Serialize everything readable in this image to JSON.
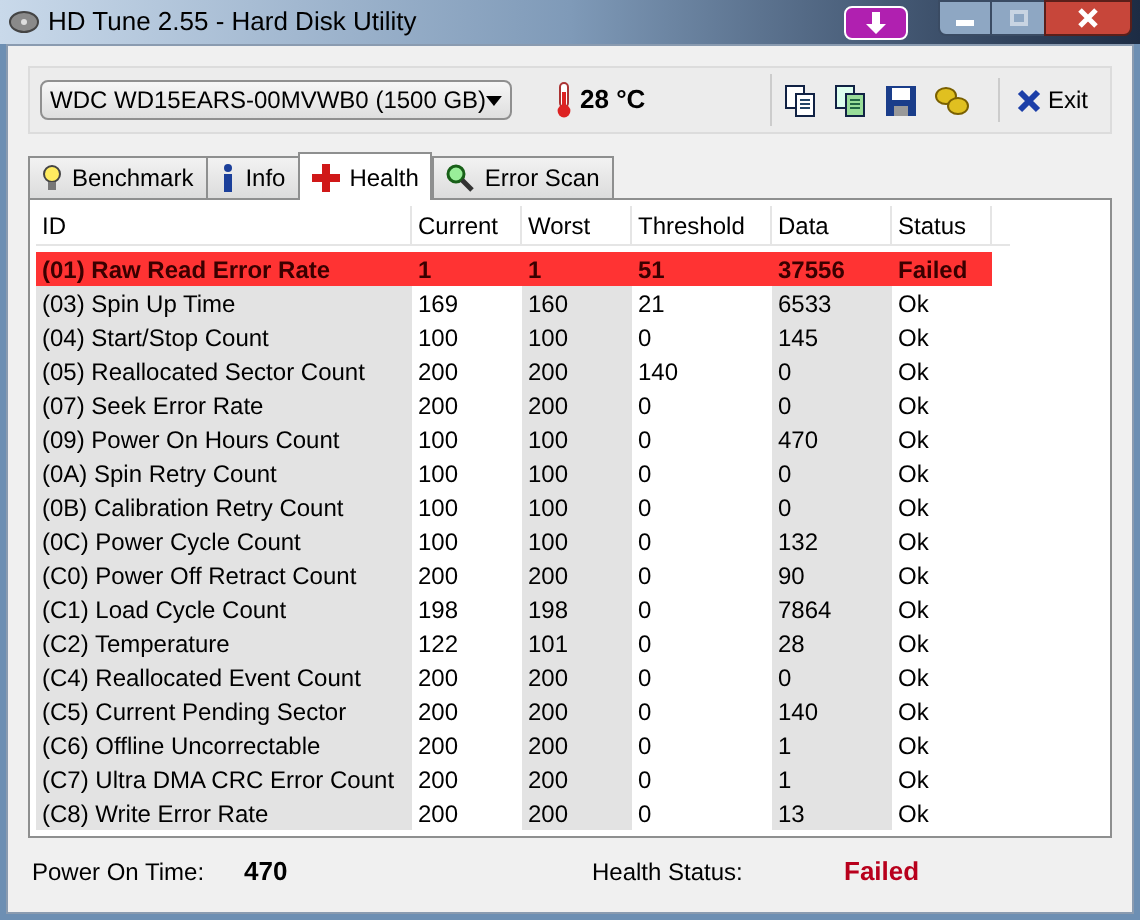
{
  "window": {
    "title": "HD Tune 2.55 - Hard Disk Utility"
  },
  "drive_select": {
    "value": "WDC WD15EARS-00MVWB0 (1500 GB)"
  },
  "temperature": "28 °C",
  "exit_button": {
    "label": "Exit"
  },
  "tabs": [
    {
      "label": "Benchmark",
      "selected": false
    },
    {
      "label": "Info",
      "selected": false
    },
    {
      "label": "Health",
      "selected": true
    },
    {
      "label": "Error Scan",
      "selected": false
    }
  ],
  "table": {
    "columns": [
      "ID",
      "Current",
      "Worst",
      "Threshold",
      "Data",
      "Status"
    ],
    "rows": [
      {
        "id": "(01) Raw Read Error Rate",
        "current": "1",
        "worst": "1",
        "threshold": "51",
        "data": "37556",
        "status": "Failed",
        "failed": true
      },
      {
        "id": "(03) Spin Up Time",
        "current": "169",
        "worst": "160",
        "threshold": "21",
        "data": "6533",
        "status": "Ok",
        "failed": false
      },
      {
        "id": "(04) Start/Stop Count",
        "current": "100",
        "worst": "100",
        "threshold": "0",
        "data": "145",
        "status": "Ok",
        "failed": false
      },
      {
        "id": "(05) Reallocated Sector Count",
        "current": "200",
        "worst": "200",
        "threshold": "140",
        "data": "0",
        "status": "Ok",
        "failed": false
      },
      {
        "id": "(07) Seek Error Rate",
        "current": "200",
        "worst": "200",
        "threshold": "0",
        "data": "0",
        "status": "Ok",
        "failed": false
      },
      {
        "id": "(09) Power On Hours Count",
        "current": "100",
        "worst": "100",
        "threshold": "0",
        "data": "470",
        "status": "Ok",
        "failed": false
      },
      {
        "id": "(0A) Spin Retry Count",
        "current": "100",
        "worst": "100",
        "threshold": "0",
        "data": "0",
        "status": "Ok",
        "failed": false
      },
      {
        "id": "(0B) Calibration Retry Count",
        "current": "100",
        "worst": "100",
        "threshold": "0",
        "data": "0",
        "status": "Ok",
        "failed": false
      },
      {
        "id": "(0C) Power Cycle Count",
        "current": "100",
        "worst": "100",
        "threshold": "0",
        "data": "132",
        "status": "Ok",
        "failed": false
      },
      {
        "id": "(C0) Power Off Retract Count",
        "current": "200",
        "worst": "200",
        "threshold": "0",
        "data": "90",
        "status": "Ok",
        "failed": false
      },
      {
        "id": "(C1) Load Cycle Count",
        "current": "198",
        "worst": "198",
        "threshold": "0",
        "data": "7864",
        "status": "Ok",
        "failed": false
      },
      {
        "id": "(C2) Temperature",
        "current": "122",
        "worst": "101",
        "threshold": "0",
        "data": "28",
        "status": "Ok",
        "failed": false
      },
      {
        "id": "(C4) Reallocated Event Count",
        "current": "200",
        "worst": "200",
        "threshold": "0",
        "data": "0",
        "status": "Ok",
        "failed": false
      },
      {
        "id": "(C5) Current Pending Sector",
        "current": "200",
        "worst": "200",
        "threshold": "0",
        "data": "140",
        "status": "Ok",
        "failed": false
      },
      {
        "id": "(C6) Offline Uncorrectable",
        "current": "200",
        "worst": "200",
        "threshold": "0",
        "data": "1",
        "status": "Ok",
        "failed": false
      },
      {
        "id": "(C7) Ultra DMA CRC Error Count",
        "current": "200",
        "worst": "200",
        "threshold": "0",
        "data": "1",
        "status": "Ok",
        "failed": false
      },
      {
        "id": "(C8) Write Error Rate",
        "current": "200",
        "worst": "200",
        "threshold": "0",
        "data": "13",
        "status": "Ok",
        "failed": false
      }
    ]
  },
  "footer": {
    "power_on_label": "Power On Time:",
    "power_on_value": "470",
    "health_label": "Health Status:",
    "health_value": "Failed",
    "health_failed": true
  }
}
